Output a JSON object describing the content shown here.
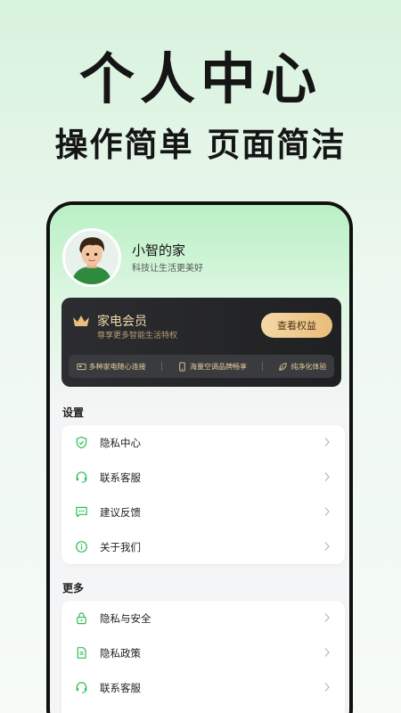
{
  "hero": {
    "title": "个人中心",
    "subtitle": "操作简单 页面简洁"
  },
  "profile": {
    "name": "小智的家",
    "slogan": "科技让生活更美好"
  },
  "vip": {
    "title": "家电会员",
    "subtitle": "尊享更多智能生活特权",
    "button_label": "查看权益",
    "features": [
      {
        "label": "多种家电随心连接",
        "icon": "device-icon"
      },
      {
        "label": "海量空调品牌畅享",
        "icon": "phone-icon"
      },
      {
        "label": "纯净化体验",
        "icon": "leaf-icon"
      }
    ]
  },
  "settings": {
    "title": "设置",
    "items": [
      {
        "label": "隐私中心",
        "icon": "shield-check-icon"
      },
      {
        "label": "联系客服",
        "icon": "headset-icon"
      },
      {
        "label": "建议反馈",
        "icon": "feedback-icon"
      },
      {
        "label": "关于我们",
        "icon": "info-icon"
      }
    ]
  },
  "more": {
    "title": "更多",
    "items": [
      {
        "label": "隐私与安全",
        "icon": "lock-icon"
      },
      {
        "label": "隐私政策",
        "icon": "document-icon"
      },
      {
        "label": "联系客服",
        "icon": "headset-icon"
      }
    ]
  },
  "colors": {
    "accent_green": "#2fbf57",
    "vip_gold": "#e9bd7a",
    "vip_dark": "#27282b"
  }
}
